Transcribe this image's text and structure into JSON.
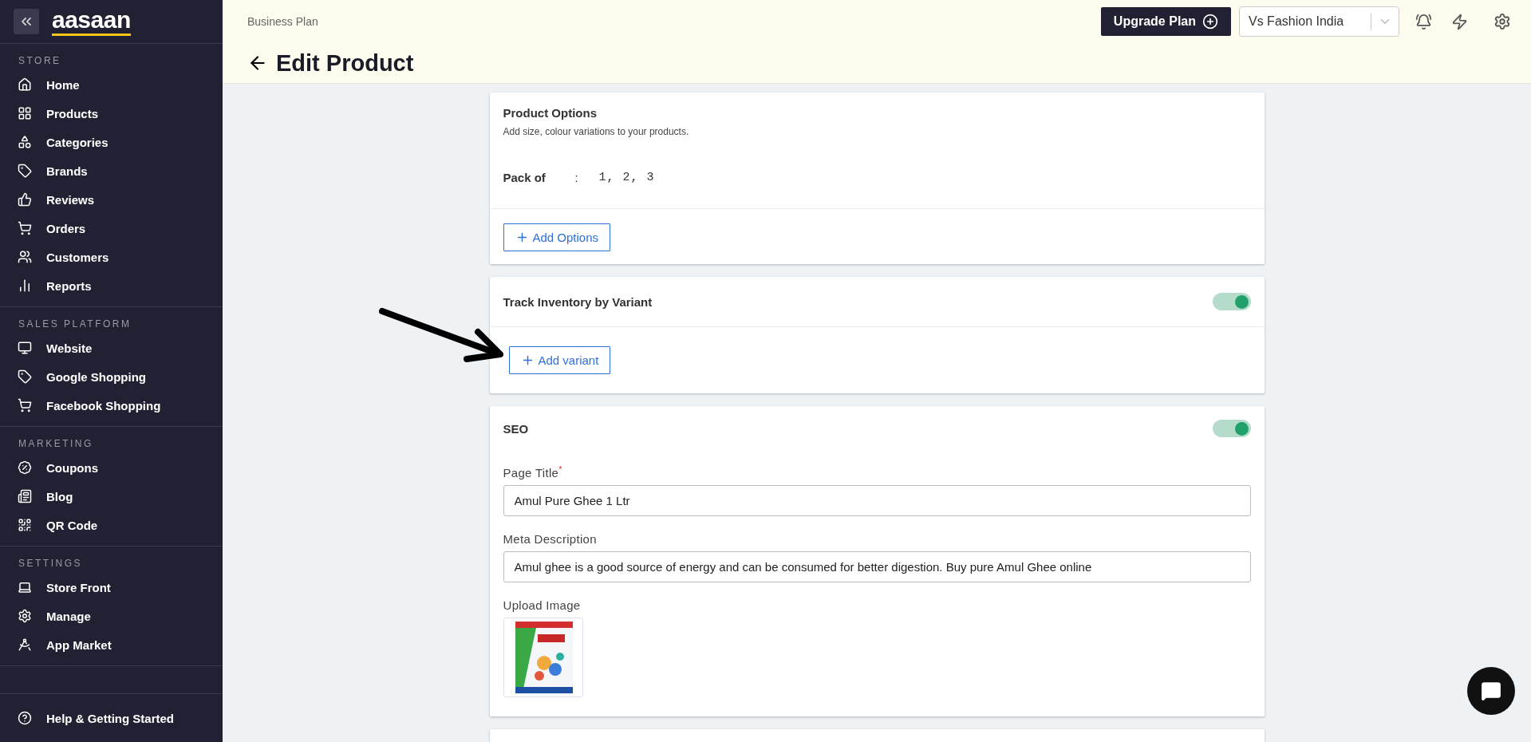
{
  "sidebar": {
    "logo": "aasaan",
    "sections": [
      {
        "heading": "STORE",
        "items": [
          {
            "label": "Home"
          },
          {
            "label": "Products"
          },
          {
            "label": "Categories"
          },
          {
            "label": "Brands"
          },
          {
            "label": "Reviews"
          },
          {
            "label": "Orders"
          },
          {
            "label": "Customers"
          },
          {
            "label": "Reports"
          }
        ]
      },
      {
        "heading": "SALES PLATFORM",
        "items": [
          {
            "label": "Website"
          },
          {
            "label": "Google Shopping"
          },
          {
            "label": "Facebook Shopping"
          }
        ]
      },
      {
        "heading": "MARKETING",
        "items": [
          {
            "label": "Coupons"
          },
          {
            "label": "Blog"
          },
          {
            "label": "QR Code"
          }
        ]
      },
      {
        "heading": "SETTINGS",
        "items": [
          {
            "label": "Store Front"
          },
          {
            "label": "Manage"
          },
          {
            "label": "App Market"
          }
        ]
      }
    ],
    "footer": {
      "label": "Help & Getting Started"
    }
  },
  "header": {
    "plan": "Business Plan",
    "upgrade_button": "Upgrade Plan",
    "store_select": {
      "value": "Vs Fashion India"
    },
    "title": "Edit Product"
  },
  "product_options": {
    "title": "Product Options",
    "subtitle": "Add size, colour variations to your products.",
    "options": [
      {
        "name": "Pack of",
        "separator": ":",
        "values": "1, 2, 3"
      }
    ],
    "button": "Add Options"
  },
  "track_inventory": {
    "title": "Track Inventory by Variant",
    "on": true,
    "button": "Add variant"
  },
  "seo": {
    "title": "SEO",
    "on": true,
    "fields": [
      {
        "label": "Page Title$^{*}$",
        "value": "Amul Pure Ghee 1 Ltr"
      },
      {
        "label": "Meta Description",
        "value": "Amul ghee is a good source of energy and can be consumed for better digestion. Buy pure Amul Ghee online"
      }
    ],
    "upload_label": "Upload Image"
  }
}
